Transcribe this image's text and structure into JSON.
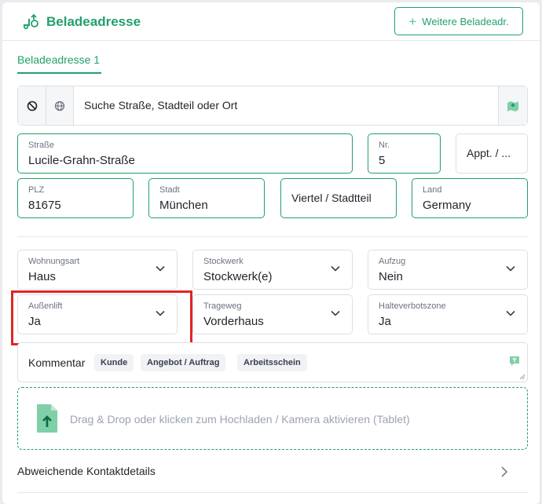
{
  "header": {
    "title": "Beladeadresse",
    "add_button": "Weitere Beladeadr."
  },
  "tabs": [
    {
      "label": "Beladeadresse 1",
      "active": true
    }
  ],
  "search": {
    "placeholder": "Suche Straße, Stadteil oder Ort"
  },
  "address": {
    "street": {
      "label": "Straße",
      "value": "Lucile-Grahn-Straße"
    },
    "number": {
      "label": "Nr.",
      "value": "5"
    },
    "apartment": {
      "placeholder": "Appt. / ..."
    },
    "zip": {
      "label": "PLZ",
      "value": "81675"
    },
    "city": {
      "label": "Stadt",
      "value": "München"
    },
    "district": {
      "placeholder": "Viertel / Stadtteil"
    },
    "country": {
      "label": "Land",
      "value": "Germany"
    }
  },
  "selects": {
    "wohnungsart": {
      "label": "Wohnungsart",
      "value": "Haus"
    },
    "stockwerk": {
      "label": "Stockwerk",
      "value": "Stockwerk(e)"
    },
    "aufzug": {
      "label": "Aufzug",
      "value": "Nein"
    },
    "aussenlift": {
      "label": "Außenlift",
      "value": "Ja"
    },
    "trageweg": {
      "label": "Trageweg",
      "value": "Vorderhaus"
    },
    "halteverbotszone": {
      "label": "Halteverbotszone",
      "value": "Ja"
    }
  },
  "comment": {
    "label": "Kommentar",
    "chips": [
      "Kunde",
      "Angebot / Auftrag",
      "Arbeitsschein"
    ]
  },
  "upload": {
    "text": "Drag & Drop oder klicken zum Hochladen / Kamera aktivieren (Tablet)"
  },
  "contact": {
    "label": "Abweichende Kontaktdetails"
  },
  "colors": {
    "accent": "#22a06b",
    "highlight": "#e02424"
  }
}
